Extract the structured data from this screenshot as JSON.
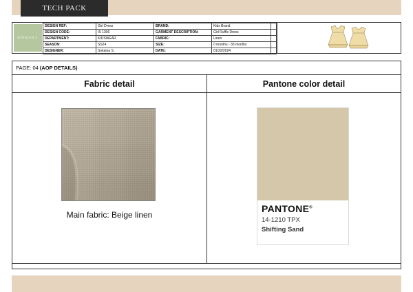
{
  "tab_label": "TECH PACK",
  "logo_text": "SOKAINA S.",
  "info_rows": [
    {
      "k1": "DESIGN REF:",
      "v1": "Girl Dress",
      "k2": "BRAND:",
      "v2": "Kids Brand"
    },
    {
      "k1": "DESIGN CODE:",
      "v1": "IS 1306",
      "k2": "GARMENT DESCRIPTION:",
      "v2": "Girl Ruffle Dress"
    },
    {
      "k1": "DEPARTMENT:",
      "v1": "KIDSWEAR",
      "k2": "FABRIC:",
      "v2": "Linen"
    },
    {
      "k1": "SEASON:",
      "v1": "SS24",
      "k2": "SIZE:",
      "v2": "0 months - 30 months"
    },
    {
      "k1": "DESIGNER:",
      "v1": "Sokaina S.",
      "k2": "DATE:",
      "v2": "01/22/2024"
    }
  ],
  "page": {
    "prefix": "PAGE: 04",
    "section": "(AOP DETAILS)"
  },
  "columns": {
    "left": "Fabric detail",
    "right": "Pantone color detail"
  },
  "fabric_caption": "Main fabric: Beige linen",
  "pantone": {
    "brand": "PANTONE",
    "reg": "®",
    "code": "14-1210 TPX",
    "name": "Shifting Sand",
    "swatch_color": "#d5c7aa"
  },
  "colors": {
    "band": "#e6d4bf",
    "tab": "#2b2b2b",
    "logo": "#b4c79f",
    "linen": "#b3a893",
    "dress": "#efdca6"
  },
  "icons": {
    "dress_front": "dress-front-sketch",
    "dress_back": "dress-back-sketch"
  }
}
